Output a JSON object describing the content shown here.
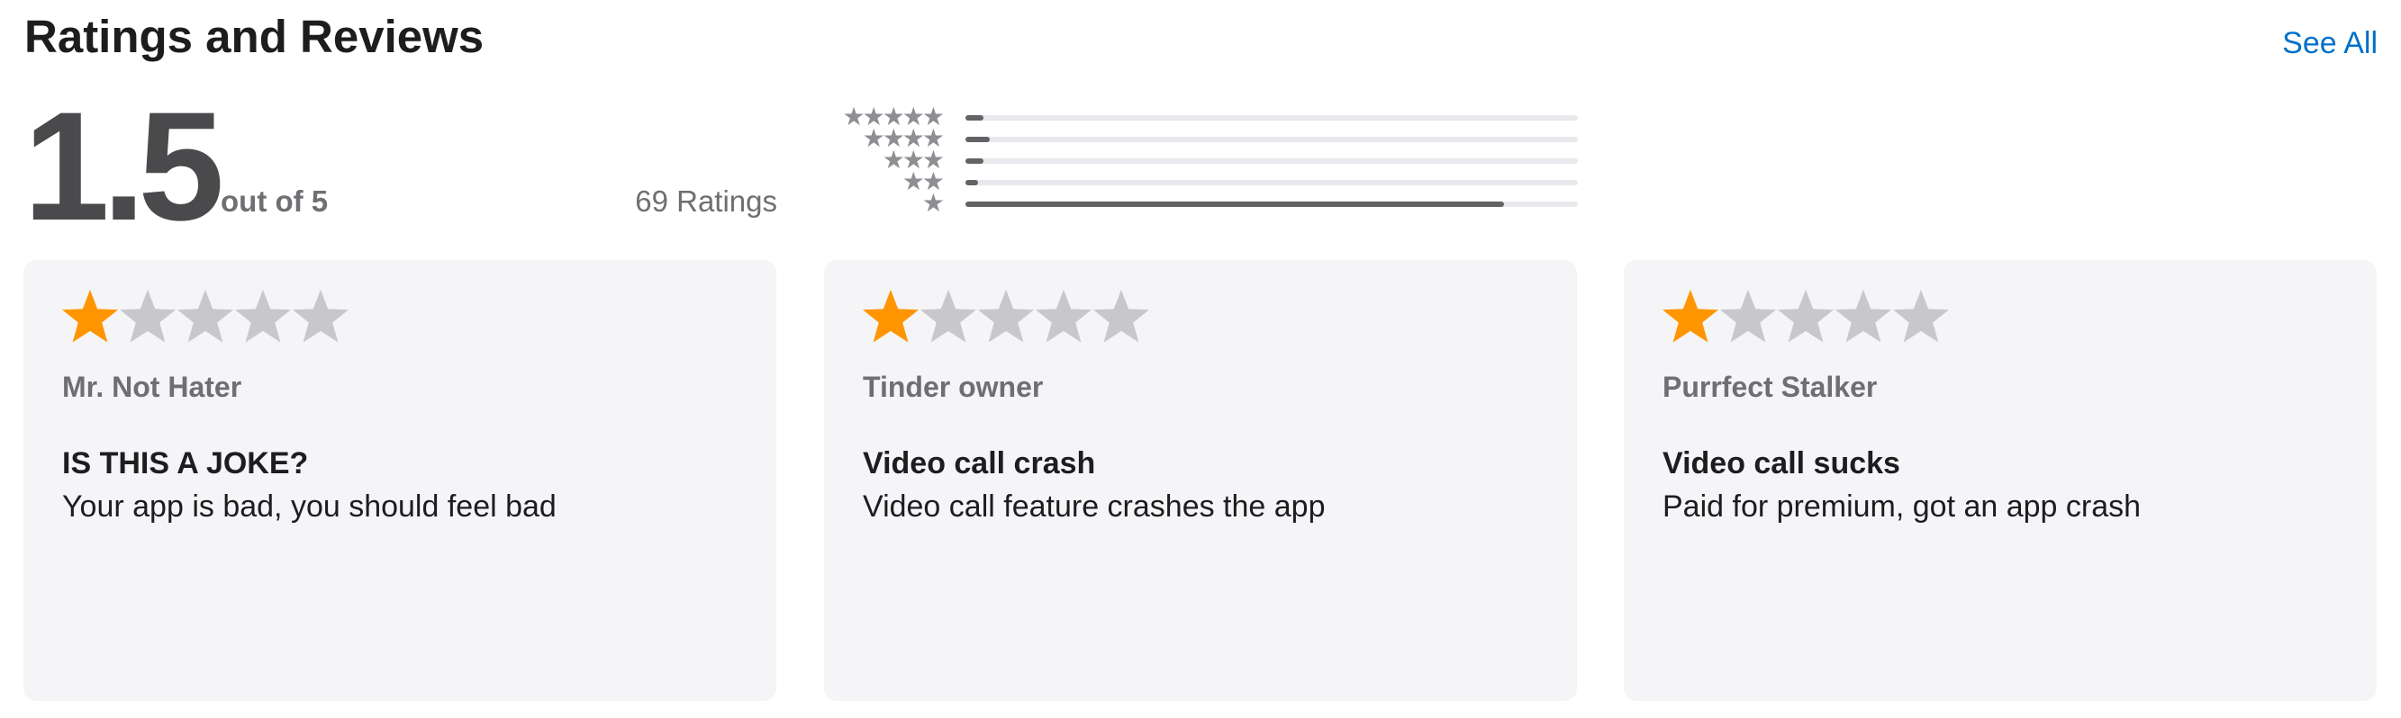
{
  "header": {
    "title": "Ratings and Reviews",
    "see_all_label": "See All"
  },
  "summary": {
    "average": "1.5",
    "out_of": "out of 5",
    "ratings_count": "69 Ratings"
  },
  "histogram": [
    {
      "stars": "★★★★★",
      "fraction": 0.03
    },
    {
      "stars": "★★★★",
      "fraction": 0.04
    },
    {
      "stars": "★★★",
      "fraction": 0.03
    },
    {
      "stars": "★★",
      "fraction": 0.02
    },
    {
      "stars": "★",
      "fraction": 0.88
    }
  ],
  "colors": {
    "accent": "#0070c9",
    "star_filled": "#ff9500",
    "star_empty": "#c7c7cc",
    "card_bg": "#f5f5f7"
  },
  "reviews": [
    {
      "rating": 1,
      "author": "Mr. Not Hater",
      "title": "IS THIS A JOKE?",
      "body": "Your app is bad, you should feel bad"
    },
    {
      "rating": 1,
      "author": "Tinder owner",
      "title": "Video call crash",
      "body": "Video call feature crashes the app"
    },
    {
      "rating": 1,
      "author": "Purrfect Stalker",
      "title": "Video call sucks",
      "body": "Paid for premium, got an app crash"
    }
  ]
}
